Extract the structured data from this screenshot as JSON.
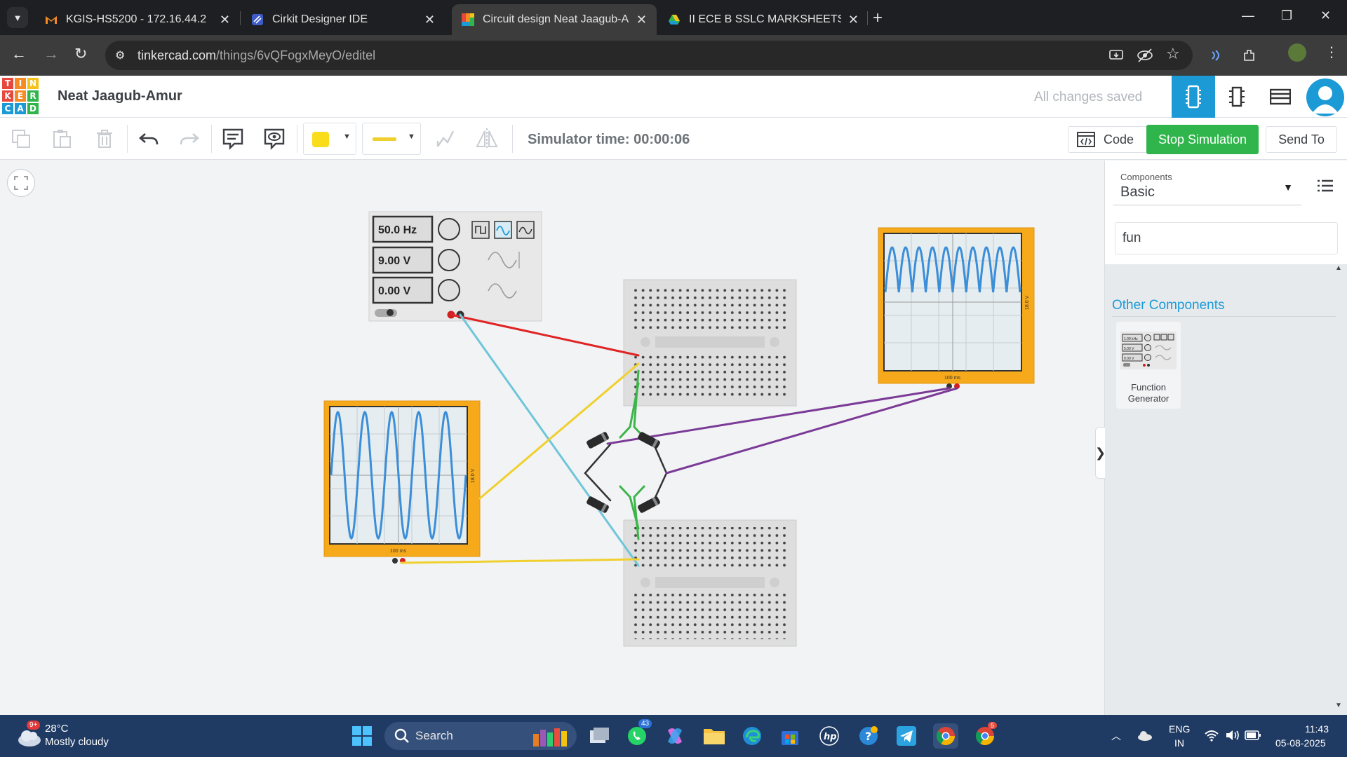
{
  "browser": {
    "tabs": [
      {
        "title": "KGIS-HS5200 - 172.16.44.2",
        "favicon": "gmail-icon"
      },
      {
        "title": "Cirkit Designer IDE",
        "favicon": "cirkit-icon"
      },
      {
        "title": "Circuit design Neat Jaagub-Am",
        "favicon": "tinkercad-icon",
        "active": true
      },
      {
        "title": "II ECE B SSLC MARKSHEETS - Go",
        "favicon": "drive-icon"
      }
    ],
    "url_host": "tinkercad.com",
    "url_path": "/things/6vQFogxMeyO/editel"
  },
  "tinkercad": {
    "logo_letters": [
      "T",
      "I",
      "N",
      "K",
      "E",
      "R",
      "C",
      "A",
      "D"
    ],
    "logo_colors": [
      "#e8473b",
      "#f58b22",
      "#f5c21b",
      "#e8473b",
      "#f58b22",
      "#2fb54b",
      "#1b9ad6",
      "#1b9ad6",
      "#2fb54b"
    ],
    "design_name": "Neat Jaagub-Amur",
    "save_status": "All changes saved",
    "simulator_time": "Simulator time: 00:00:06",
    "code_label": "Code",
    "stop_label": "Stop Simulation",
    "send_label": "Send To"
  },
  "function_generator": {
    "frequency": "50.0 Hz",
    "amplitude": "9.00 V",
    "offset": "0.00 V"
  },
  "oscilloscope_left": {
    "time_label": "100 ms",
    "volt_label": "18.0 V",
    "waveform": "sine"
  },
  "oscilloscope_right": {
    "time_label": "100 ms",
    "volt_label": "18.0 V",
    "waveform": "full-wave rectified"
  },
  "panel": {
    "components_label": "Components",
    "components_value": "Basic",
    "search_value": "fun",
    "other_components": "Other Components",
    "card_name": "Function Generator",
    "card_preview": [
      "1.00 kHz",
      "5.00 V",
      "0.00 V"
    ]
  },
  "taskbar": {
    "temperature": "28°C",
    "condition": "Mostly cloudy",
    "weather_badge": "9+",
    "search_placeholder": "Search",
    "whatsapp_badge": "43",
    "chrome_badge": "5",
    "language": "ENG",
    "region": "IN",
    "time": "11:43",
    "date": "05-08-2025"
  },
  "colors": {
    "accent": "#1b9ad6",
    "stop_green": "#2fb54b",
    "scope_orange": "#f5a91b",
    "wire_red": "#e02424",
    "wire_yellow": "#f0d02e",
    "wire_cyan": "#6ec6d9",
    "wire_green": "#3db54a",
    "wire_purple": "#7b3a96"
  }
}
